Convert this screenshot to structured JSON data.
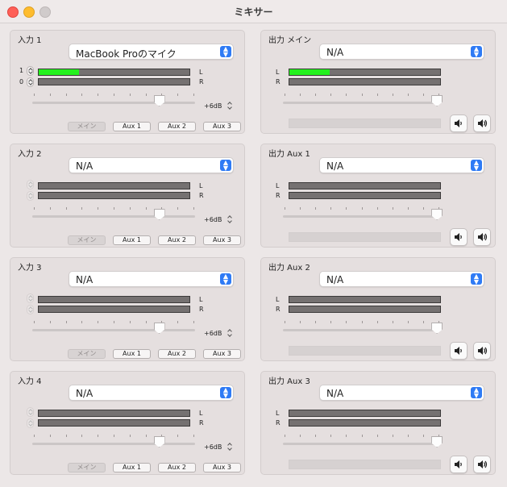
{
  "window": {
    "title": "ミキサー",
    "traffic_lights": [
      "close",
      "minimize",
      "zoom"
    ]
  },
  "inputs": [
    {
      "label": "入力 1",
      "device": "MacBook Proのマイク",
      "channel_steppers": [
        {
          "value": "1",
          "enabled": true
        },
        {
          "value": "0",
          "enabled": true
        }
      ],
      "meter_L_level": 0.27,
      "meter_R_level": 0,
      "gain": "+6dB",
      "slider_level": 0.78,
      "routes": [
        {
          "label": "メイン",
          "enabled": false
        },
        {
          "label": "Aux 1",
          "enabled": true
        },
        {
          "label": "Aux 2",
          "enabled": true
        },
        {
          "label": "Aux 3",
          "enabled": true
        }
      ]
    },
    {
      "label": "入力 2",
      "device": "N/A",
      "channel_steppers": [
        {
          "value": "",
          "enabled": false
        },
        {
          "value": "",
          "enabled": false
        }
      ],
      "meter_L_level": 0,
      "meter_R_level": 0,
      "gain": "+6dB",
      "slider_level": 0.78,
      "routes": [
        {
          "label": "メイン",
          "enabled": false
        },
        {
          "label": "Aux 1",
          "enabled": true
        },
        {
          "label": "Aux 2",
          "enabled": true
        },
        {
          "label": "Aux 3",
          "enabled": true
        }
      ]
    },
    {
      "label": "入力 3",
      "device": "N/A",
      "channel_steppers": [
        {
          "value": "",
          "enabled": false
        },
        {
          "value": "",
          "enabled": false
        }
      ],
      "meter_L_level": 0,
      "meter_R_level": 0,
      "gain": "+6dB",
      "slider_level": 0.78,
      "routes": [
        {
          "label": "メイン",
          "enabled": false
        },
        {
          "label": "Aux 1",
          "enabled": true
        },
        {
          "label": "Aux 2",
          "enabled": true
        },
        {
          "label": "Aux 3",
          "enabled": true
        }
      ]
    },
    {
      "label": "入力 4",
      "device": "N/A",
      "channel_steppers": [
        {
          "value": "",
          "enabled": false
        },
        {
          "value": "",
          "enabled": false
        }
      ],
      "meter_L_level": 0,
      "meter_R_level": 0,
      "gain": "+6dB",
      "slider_level": 0.78,
      "routes": [
        {
          "label": "メイン",
          "enabled": false
        },
        {
          "label": "Aux 1",
          "enabled": true
        },
        {
          "label": "Aux 2",
          "enabled": true
        },
        {
          "label": "Aux 3",
          "enabled": true
        }
      ]
    }
  ],
  "outputs": [
    {
      "label": "出力 メイン",
      "device": "N/A",
      "meter_L_level": 0.27,
      "meter_R_level": 0,
      "slider_level": 0.98
    },
    {
      "label": "出力 Aux 1",
      "device": "N/A",
      "meter_L_level": 0,
      "meter_R_level": 0,
      "slider_level": 0.98
    },
    {
      "label": "出力 Aux 2",
      "device": "N/A",
      "meter_L_level": 0,
      "meter_R_level": 0,
      "slider_level": 0.98
    },
    {
      "label": "出力 Aux 3",
      "device": "N/A",
      "meter_L_level": 0,
      "meter_R_level": 0,
      "slider_level": 0.98
    }
  ],
  "meter_labels": {
    "left": "L",
    "right": "R"
  },
  "icons": {
    "mute": "speaker-mute-icon",
    "unmute": "speaker-loud-icon",
    "select": "chevron-updown-icon"
  },
  "colors": {
    "meter_fill": "#23f01c",
    "select_accent": "#2f7bf5"
  }
}
